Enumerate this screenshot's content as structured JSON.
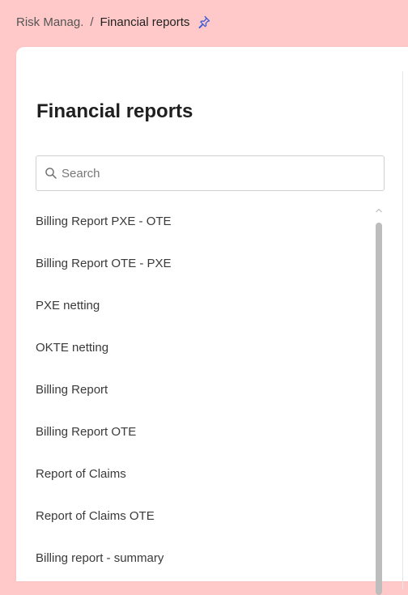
{
  "breadcrumb": {
    "parent": "Risk Manag.",
    "separator": "/",
    "current": "Financial reports"
  },
  "page": {
    "title": "Financial reports"
  },
  "search": {
    "placeholder": "Search",
    "value": ""
  },
  "list": {
    "items": [
      {
        "label": "Billing Report PXE - OTE"
      },
      {
        "label": "Billing Report OTE - PXE"
      },
      {
        "label": "PXE netting"
      },
      {
        "label": "OKTE netting"
      },
      {
        "label": "Billing Report"
      },
      {
        "label": "Billing Report OTE"
      },
      {
        "label": "Report of Claims"
      },
      {
        "label": "Report of Claims OTE"
      },
      {
        "label": "Billing report - summary"
      }
    ]
  },
  "icons": {
    "pin": "pin-icon",
    "search": "search-icon",
    "scroll_up": "chevron-up-icon"
  },
  "colors": {
    "background": "#ffc9c9",
    "panel": "#ffffff",
    "pin_icon": "#3b5bd6"
  }
}
